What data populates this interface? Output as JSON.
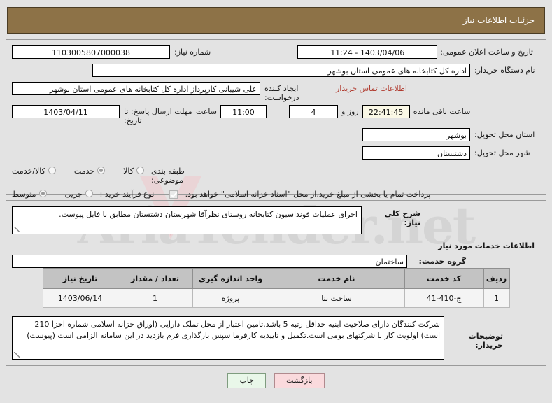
{
  "header": {
    "title": "جزئیات اطلاعات نیاز",
    "bg_color": "#8d7247"
  },
  "watermark": {
    "text": "AriaTender.net"
  },
  "form": {
    "need_number": {
      "label": "شماره نیاز:",
      "value": "1103005807000038"
    },
    "announce_datetime": {
      "label": "تاریخ و ساعت اعلان عمومی:",
      "value": "1403/04/06 - 11:24"
    },
    "buyer_org": {
      "label": "نام دستگاه خریدار:",
      "value": "اداره کل کتابخانه های عمومی استان بوشهر"
    },
    "requester": {
      "label": "ایجاد کننده درخواست:",
      "value": "علی شیبانی کارپرداز اداره کل کتابخانه های عمومی استان بوشهر"
    },
    "buyer_contact_link": "اطلاعات تماس خریدار",
    "deadline": {
      "label": "مهلت ارسال پاسخ: تا تاریخ:",
      "date": "1403/04/11",
      "time_label": "ساعت",
      "time": "11:00",
      "days": "4",
      "days_label": "روز و",
      "remaining": "22:41:45",
      "remaining_label": "ساعت باقی مانده"
    },
    "delivery_province": {
      "label": "استان محل تحویل:",
      "value": "بوشهر"
    },
    "delivery_city": {
      "label": "شهر محل تحویل:",
      "value": "دشتستان"
    },
    "subject_class": {
      "label": "طبقه بندی موضوعی:",
      "options": [
        {
          "label": "کالا",
          "selected": false
        },
        {
          "label": "خدمت",
          "selected": true
        },
        {
          "label": "کالا/خدمت",
          "selected": false
        }
      ]
    },
    "purchase_process": {
      "label": "نوع فرآیند خرید :",
      "options": [
        {
          "label": "جزیی",
          "selected": false
        },
        {
          "label": "متوسط",
          "selected": true
        }
      ],
      "checkbox": {
        "checked": true,
        "label": "پرداخت تمام یا بخشی از مبلغ خرید،از محل \"اسناد خزانه اسلامی\" خواهد بود."
      }
    }
  },
  "body": {
    "need_summary": {
      "label": "شرح کلی نیاز:",
      "value": "اجرای عملیات فونداسیون کتابخانه روستای نظرآقا شهرستان دشتستان مطابق با فایل پیوست."
    },
    "services_heading": "اطلاعات خدمات مورد نیاز",
    "service_group": {
      "label": "گروه خدمت:",
      "value": "ساختمان"
    },
    "table": {
      "columns": [
        "ردیف",
        "کد خدمت",
        "نام خدمت",
        "واحد اندازه گیری",
        "تعداد / مقدار",
        "تاریخ نیاز"
      ],
      "rows": [
        {
          "row": "1",
          "code": "ج-410-41",
          "name": "ساخت بنا",
          "unit": "پروژه",
          "qty": "1",
          "date": "1403/06/14"
        }
      ]
    },
    "buyer_notes": {
      "label": "توضیحات خریدار:",
      "value": "شرکت کنندگان دارای صلاحیت ابنیه حداقل رتبه 5 باشد.تامین اعتبار از محل تملک دارایی (اوراق خزانه اسلامی شماره اخزا 210 است) اولویت کار با شرکتهای بومی است.تکمیل و تاییدیه کارفرما سپس بارگذاری فرم بازدید در این سامانه الزامی است (پیوست)"
    }
  },
  "buttons": {
    "print": {
      "label": "چاپ",
      "color": "#e9f7e9"
    },
    "back": {
      "label": "بازگشت",
      "color": "#fadadd"
    }
  }
}
